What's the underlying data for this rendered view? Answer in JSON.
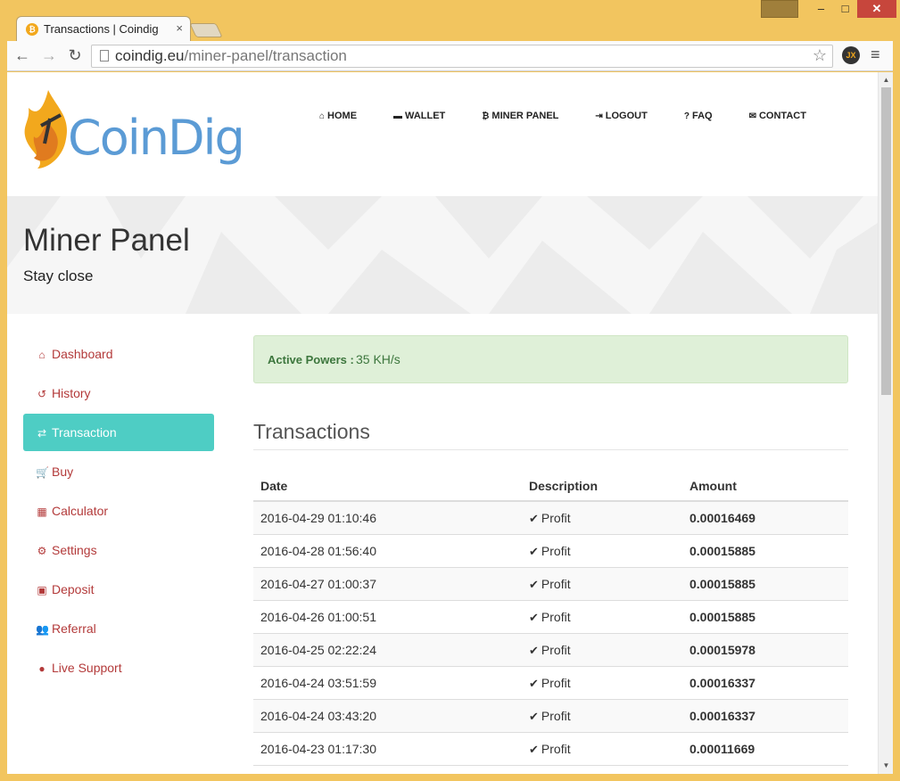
{
  "browser": {
    "tab_title": "Transactions | Coindig",
    "tab_close": "×",
    "url_host": "coindig.eu",
    "url_path": "/miner-panel/transaction",
    "controls": {
      "minimize": "–",
      "maximize": "□",
      "close": "✕"
    }
  },
  "site": {
    "logo_text": "CoinDig",
    "nav": [
      {
        "label": "HOME",
        "icon": "home-icon",
        "glyph": "⌂"
      },
      {
        "label": "WALLET",
        "icon": "card-icon",
        "glyph": "▬"
      },
      {
        "label": "MINER PANEL",
        "icon": "bitcoin-icon",
        "glyph": "₿"
      },
      {
        "label": "LOGOUT",
        "icon": "logout-icon",
        "glyph": "⇥"
      },
      {
        "label": "FAQ",
        "icon": "question-icon",
        "glyph": "?"
      },
      {
        "label": "CONTACT",
        "icon": "envelope-icon",
        "glyph": "✉"
      }
    ]
  },
  "banner": {
    "title": "Miner Panel",
    "subtitle": "Stay close"
  },
  "sidebar": {
    "items": [
      {
        "label": "Dashboard",
        "glyph": "⌂"
      },
      {
        "label": "History",
        "glyph": "↺"
      },
      {
        "label": "Transaction",
        "glyph": "⇄"
      },
      {
        "label": "Buy",
        "glyph": "🛒"
      },
      {
        "label": "Calculator",
        "glyph": "▦"
      },
      {
        "label": "Settings",
        "glyph": "⚙"
      },
      {
        "label": "Deposit",
        "glyph": "▣"
      },
      {
        "label": "Referral",
        "glyph": "👥"
      },
      {
        "label": "Live Support",
        "glyph": "●"
      }
    ]
  },
  "alert": {
    "label": "Active Powers :",
    "value": "35 KH/s"
  },
  "transactions": {
    "title": "Transactions",
    "columns": [
      "Date",
      "Description",
      "Amount"
    ],
    "rows": [
      {
        "date": "2016-04-29 01:10:46",
        "desc": "Profit",
        "amount": "0.00016469"
      },
      {
        "date": "2016-04-28 01:56:40",
        "desc": "Profit",
        "amount": "0.00015885"
      },
      {
        "date": "2016-04-27 01:00:37",
        "desc": "Profit",
        "amount": "0.00015885"
      },
      {
        "date": "2016-04-26 01:00:51",
        "desc": "Profit",
        "amount": "0.00015885"
      },
      {
        "date": "2016-04-25 02:22:24",
        "desc": "Profit",
        "amount": "0.00015978"
      },
      {
        "date": "2016-04-24 03:51:59",
        "desc": "Profit",
        "amount": "0.00016337"
      },
      {
        "date": "2016-04-24 03:43:20",
        "desc": "Profit",
        "amount": "0.00016337"
      },
      {
        "date": "2016-04-23 01:17:30",
        "desc": "Profit",
        "amount": "0.00011669"
      }
    ]
  },
  "colors": {
    "sidebar_active": "#4ecdc4",
    "sidebar_link": "#b33a3a",
    "alert_bg": "#dff0d8",
    "logo_blue": "#5b9bd5",
    "logo_flame": "#f2a81d"
  }
}
